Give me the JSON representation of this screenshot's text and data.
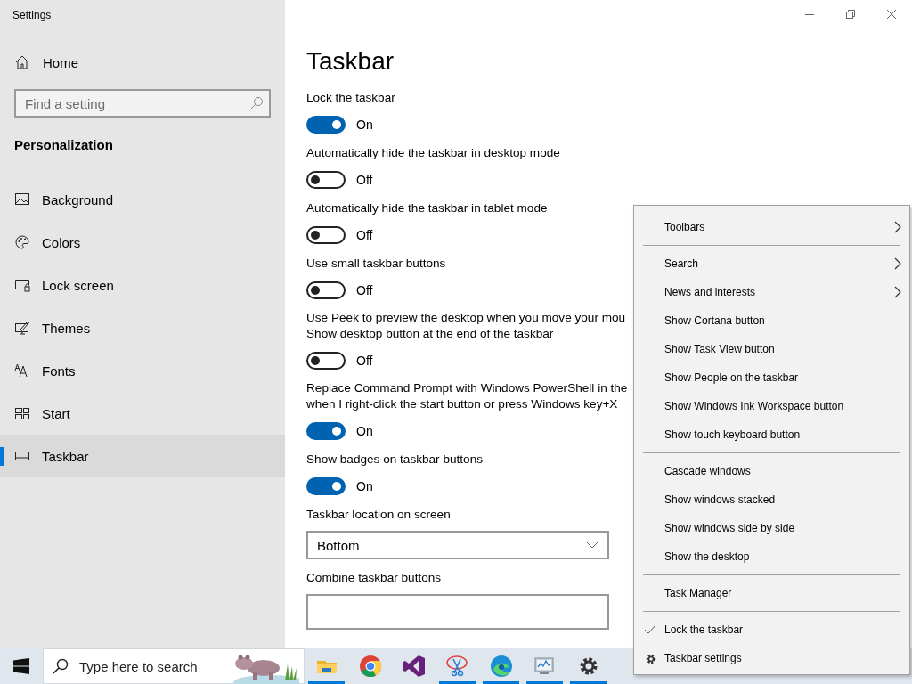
{
  "window": {
    "title": "Settings"
  },
  "sidebar": {
    "home": "Home",
    "search": {
      "placeholder": "Find a setting"
    },
    "section": "Personalization",
    "items": [
      {
        "label": "Background",
        "selected": false
      },
      {
        "label": "Colors",
        "selected": false
      },
      {
        "label": "Lock screen",
        "selected": false
      },
      {
        "label": "Themes",
        "selected": false
      },
      {
        "label": "Fonts",
        "selected": false
      },
      {
        "label": "Start",
        "selected": false
      },
      {
        "label": "Taskbar",
        "selected": true
      }
    ]
  },
  "main": {
    "heading": "Taskbar",
    "settings": [
      {
        "kind": "toggle",
        "lines": [
          "Lock the taskbar"
        ],
        "on": true,
        "state_text": "On"
      },
      {
        "kind": "toggle",
        "lines": [
          "Automatically hide the taskbar in desktop mode"
        ],
        "on": false,
        "state_text": "Off"
      },
      {
        "kind": "toggle",
        "lines": [
          "Automatically hide the taskbar in tablet mode"
        ],
        "on": false,
        "state_text": "Off"
      },
      {
        "kind": "toggle",
        "lines": [
          "Use small taskbar buttons"
        ],
        "on": false,
        "state_text": "Off"
      },
      {
        "kind": "toggle",
        "lines": [
          "Use Peek to preview the desktop when you move your mou",
          "Show desktop button at the end of the taskbar"
        ],
        "on": false,
        "state_text": "Off"
      },
      {
        "kind": "toggle",
        "lines": [
          "Replace Command Prompt with Windows PowerShell in the",
          "when I right-click the start button or press Windows key+X"
        ],
        "on": true,
        "state_text": "On"
      },
      {
        "kind": "toggle",
        "lines": [
          "Show badges on taskbar buttons"
        ],
        "on": true,
        "state_text": "On"
      },
      {
        "kind": "dropdown",
        "lines": [
          "Taskbar location on screen"
        ],
        "value": "Bottom"
      },
      {
        "kind": "dropdown",
        "lines": [
          "Combine taskbar buttons"
        ]
      }
    ]
  },
  "context_menu": {
    "groups": [
      [
        {
          "label": "Toolbars",
          "submenu": true,
          "checked": false,
          "icon": false
        }
      ],
      [
        {
          "label": "Search",
          "submenu": true,
          "checked": false,
          "icon": false
        },
        {
          "label": "News and interests",
          "submenu": true,
          "checked": false,
          "icon": false
        },
        {
          "label": "Show Cortana button",
          "submenu": false,
          "checked": false,
          "icon": false
        },
        {
          "label": "Show Task View button",
          "submenu": false,
          "checked": false,
          "icon": false
        },
        {
          "label": "Show People on the taskbar",
          "submenu": false,
          "checked": false,
          "icon": false
        },
        {
          "label": "Show Windows Ink Workspace button",
          "submenu": false,
          "checked": false,
          "icon": false
        },
        {
          "label": "Show touch keyboard button",
          "submenu": false,
          "checked": false,
          "icon": false
        }
      ],
      [
        {
          "label": "Cascade windows",
          "submenu": false,
          "checked": false,
          "icon": false
        },
        {
          "label": "Show windows stacked",
          "submenu": false,
          "checked": false,
          "icon": false
        },
        {
          "label": "Show windows side by side",
          "submenu": false,
          "checked": false,
          "icon": false
        },
        {
          "label": "Show the desktop",
          "submenu": false,
          "checked": false,
          "icon": false
        }
      ],
      [
        {
          "label": "Task Manager",
          "submenu": false,
          "checked": false,
          "icon": false
        }
      ],
      [
        {
          "label": "Lock the taskbar",
          "submenu": false,
          "checked": true,
          "icon": false
        },
        {
          "label": "Taskbar settings",
          "submenu": false,
          "checked": false,
          "icon": true
        }
      ]
    ]
  },
  "taskbar": {
    "search": {
      "placeholder": "Type here to search"
    },
    "apps": [
      {
        "running": true
      },
      {
        "running": false
      },
      {
        "running": false
      },
      {
        "running": true
      },
      {
        "running": true
      },
      {
        "running": true
      },
      {
        "running": true
      }
    ]
  }
}
